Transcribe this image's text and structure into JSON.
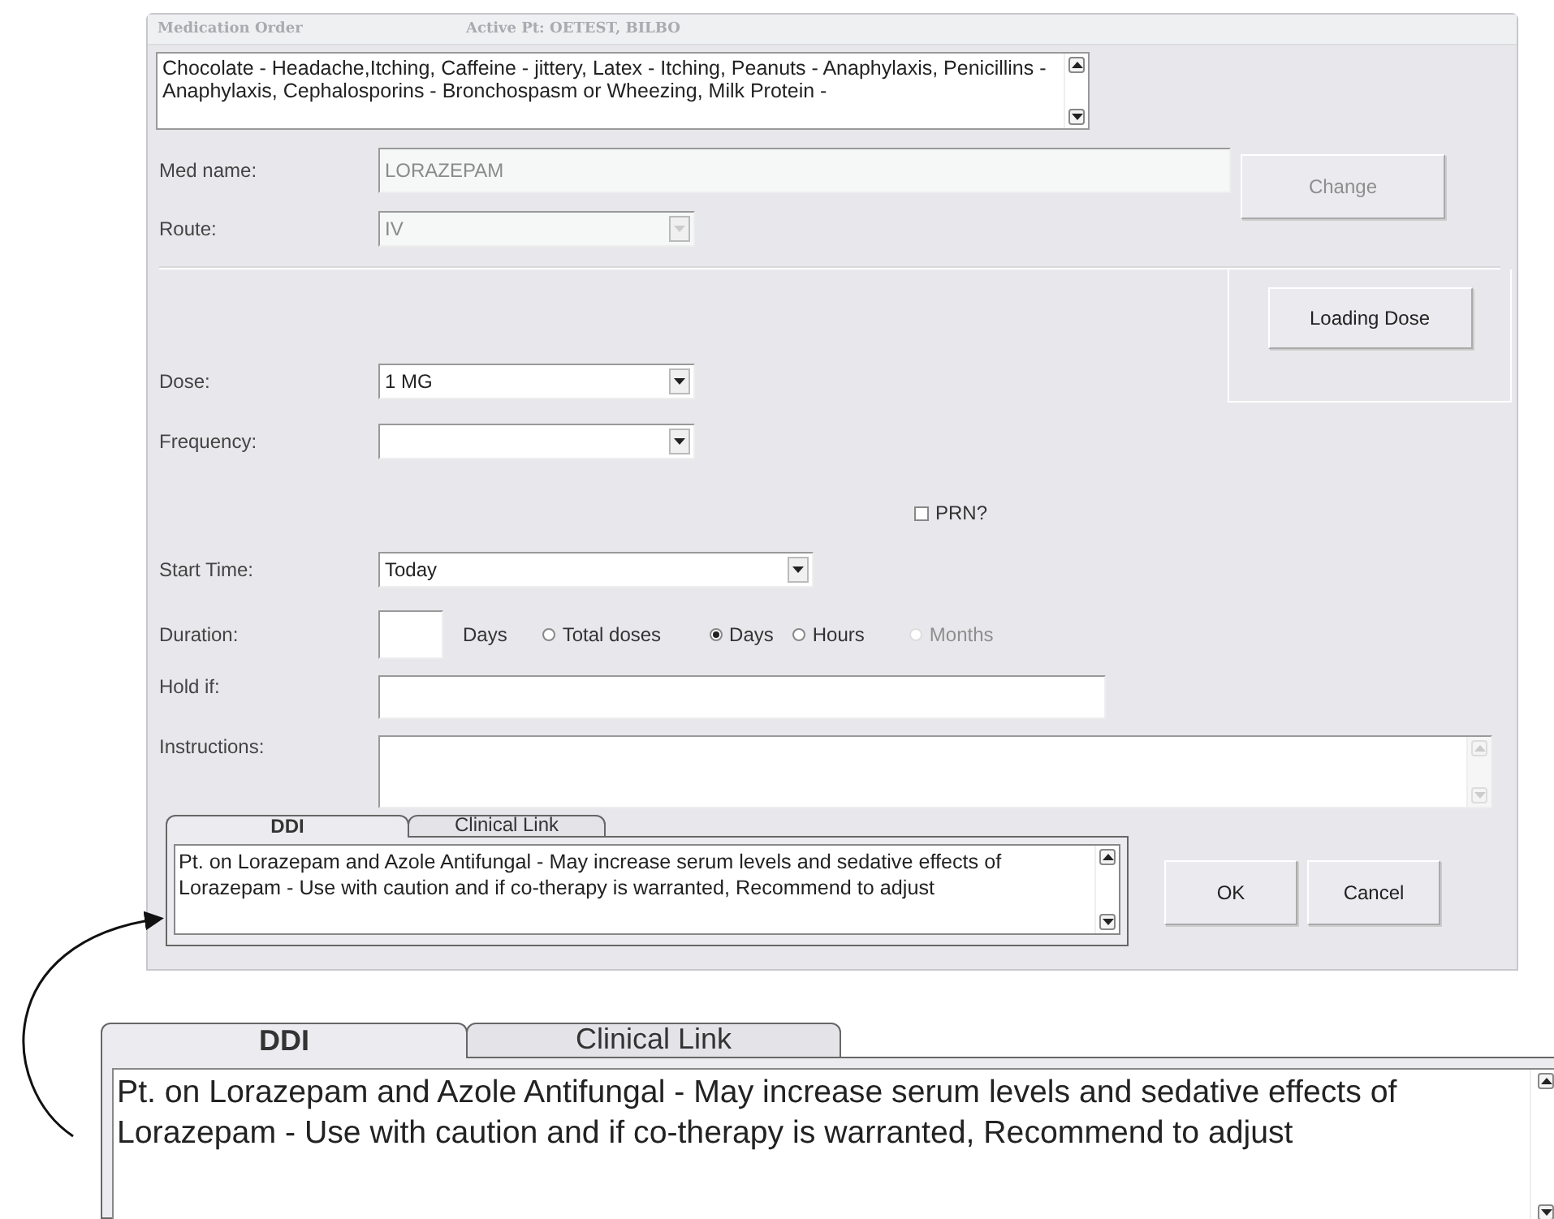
{
  "window": {
    "title": "Medication Order",
    "patient": "Active Pt: OETEST, BILBO"
  },
  "allergies": "Chocolate - Headache,Itching, Caffeine - jittery, Latex - Itching, Peanuts - Anaphylaxis, Penicillins - Anaphylaxis, Cephalosporins - Bronchospasm or Wheezing, Milk Protein -",
  "med_name": {
    "label": "Med name:",
    "value": "LORAZEPAM",
    "disabled": true
  },
  "route": {
    "label": "Route:",
    "value": "IV",
    "disabled": true
  },
  "change_button": {
    "label": "Change",
    "disabled": true
  },
  "loading_dose_button": {
    "label": "Loading Dose",
    "disabled": false
  },
  "dose": {
    "label": "Dose:",
    "value": "1 MG"
  },
  "frequency": {
    "label": "Frequency:"
  },
  "prn": {
    "label": "PRN?",
    "checked": false
  },
  "start_time": {
    "label": "Start Time:",
    "value": "Today"
  },
  "duration": {
    "label": "Duration:",
    "unit": "Days",
    "options": [
      {
        "label": "Total doses",
        "selected": false,
        "disabled": false
      },
      {
        "label": "Days",
        "selected": true,
        "disabled": false
      },
      {
        "label": "Hours",
        "selected": false,
        "disabled": false
      },
      {
        "label": "Months",
        "selected": false,
        "disabled": true
      }
    ]
  },
  "hold_if": {
    "label": "Hold if:"
  },
  "instructions": {
    "label": "Instructions:"
  },
  "tabs": [
    {
      "label": "DDI",
      "selected": true
    },
    {
      "label": "Clinical Link",
      "selected": false
    }
  ],
  "ddi_text": "Pt. on Lorazepam and Azole Antifungal - May increase serum levels and sedative effects of Lorazepam - Use with caution and if co-therapy is warranted, Recommend to adjust",
  "buttons": [
    "OK",
    "Cancel"
  ],
  "callout": {
    "tabs": [
      {
        "label": "DDI",
        "selected": true
      },
      {
        "label": "Clinical Link",
        "selected": false
      }
    ],
    "ddi_text": "Pt. on Lorazepam and Azole Antifungal - May increase serum levels and sedative effects of Lorazepam - Use with caution and if co-therapy is warranted, Recommend to adjust"
  }
}
